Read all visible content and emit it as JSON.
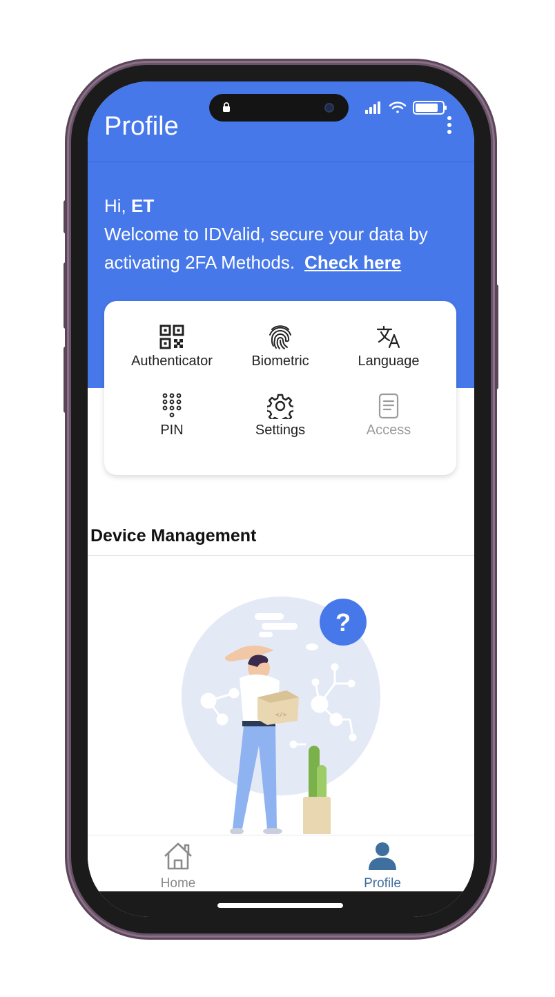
{
  "colors": {
    "accent": "#4778ea",
    "nav_active": "#3f6f9f",
    "nav_inactive": "#8a8a8a"
  },
  "header": {
    "title": "Profile",
    "menu_icon": "more-vert-icon"
  },
  "status_bar": {
    "icons": [
      "lock-icon",
      "signal-icon",
      "wifi-icon",
      "battery-icon"
    ]
  },
  "welcome": {
    "hi": "Hi,",
    "name": "ET",
    "message": "Welcome to IDValid, secure your data by activating 2FA Methods.",
    "link": "Check here"
  },
  "quick_actions": [
    {
      "label": "Authenticator",
      "icon": "qr-code-icon",
      "enabled": true
    },
    {
      "label": "Biometric",
      "icon": "fingerprint-icon",
      "enabled": true
    },
    {
      "label": "Language",
      "icon": "translate-icon",
      "enabled": true
    },
    {
      "label": "PIN",
      "icon": "dialpad-icon",
      "enabled": true
    },
    {
      "label": "Settings",
      "icon": "gear-icon",
      "enabled": true
    },
    {
      "label": "Access",
      "icon": "document-icon",
      "enabled": false
    }
  ],
  "device_management": {
    "title": "Device Management"
  },
  "bottom_nav": [
    {
      "label": "Home",
      "icon": "home-icon",
      "active": false
    },
    {
      "label": "Profile",
      "icon": "person-icon",
      "active": true
    }
  ]
}
